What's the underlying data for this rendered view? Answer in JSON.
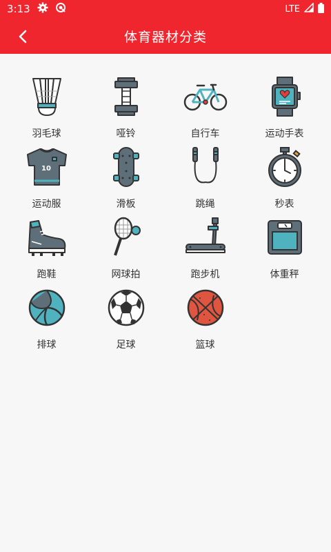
{
  "status_bar": {
    "time": "3:13",
    "network": "LTE"
  },
  "header": {
    "title": "体育器材分类"
  },
  "colors": {
    "accent": "#f0262f",
    "background": "#f7f7f7"
  },
  "categories": [
    {
      "label": "羽毛球",
      "icon": "shuttlecock-icon"
    },
    {
      "label": "哑铃",
      "icon": "dumbbell-icon"
    },
    {
      "label": "自行车",
      "icon": "bicycle-icon"
    },
    {
      "label": "运动手表",
      "icon": "smartwatch-icon"
    },
    {
      "label": "运动服",
      "icon": "jersey-icon"
    },
    {
      "label": "滑板",
      "icon": "skateboard-icon"
    },
    {
      "label": "跳绳",
      "icon": "jump-rope-icon"
    },
    {
      "label": "秒表",
      "icon": "stopwatch-icon"
    },
    {
      "label": "跑鞋",
      "icon": "running-shoe-icon"
    },
    {
      "label": "网球拍",
      "icon": "tennis-racket-icon"
    },
    {
      "label": "跑步机",
      "icon": "treadmill-icon"
    },
    {
      "label": "体重秤",
      "icon": "scale-icon"
    },
    {
      "label": "排球",
      "icon": "volleyball-icon"
    },
    {
      "label": "足球",
      "icon": "soccer-ball-icon"
    },
    {
      "label": "篮球",
      "icon": "basketball-icon"
    }
  ]
}
